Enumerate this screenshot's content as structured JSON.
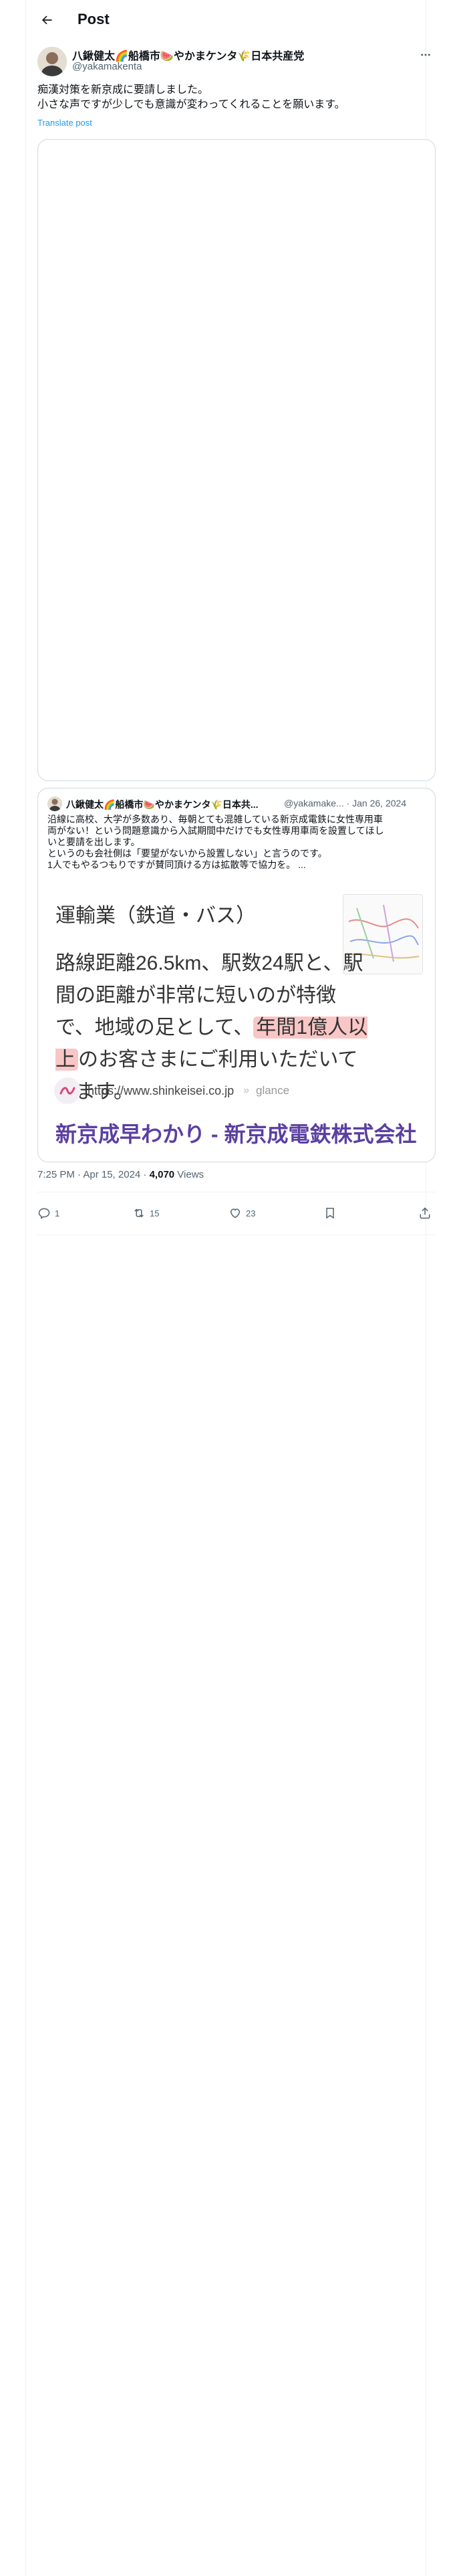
{
  "header": {
    "title": "Post"
  },
  "author": {
    "name": "八鍬健太🌈船橋市🍉やかまケンタ🌾日本共産党",
    "handle": "@yakamakenta"
  },
  "tweet": {
    "lines": [
      "痴漢対策を新京成に要請しました。",
      "小さな声ですが少しでも意識が変わってくれることを願います。"
    ],
    "translate": "Translate post"
  },
  "quote": {
    "name": "八鍬健太🌈船橋市🍉やかまケンタ🌾日本共...",
    "handle": "@yakamake...",
    "dot": "·",
    "date": "Jan 26, 2024",
    "body": [
      "沿線に高校、大学が多数あり、毎朝とても混雑している新京成電鉄に女性専用車",
      "両がない！という問題意識から入試期間中だけでも女性専用車両を設置してほし",
      "いと要請を出します。",
      "というのも会社側は「要望がないから設置しない」と言うのです。",
      "1人でもやるつもりですが賛同頂ける方は拡散等で協力を。 ..."
    ],
    "card": {
      "heading": "運輸業（鉄道・バス）",
      "route_pre": "路線距離26.5km、駅数24駅と、駅間の距離が非常に短いのが特徴で、地域の足として、",
      "route_highlight": "年間1億人以上",
      "route_post": "のお客さまにご利用いただいています。",
      "url": "https://www.shinkeisei.co.jp",
      "separator": "»",
      "glance": "glance",
      "site_title": "新京成早わかり - 新京成電鉄株式会社"
    }
  },
  "meta": {
    "time": "7:25 PM · Apr 15, 2024 · ",
    "views_count": "4,070",
    "views_label": " Views"
  },
  "actions": {
    "replies": "1",
    "reposts": "15",
    "likes": "23"
  },
  "colors": {
    "link": "#1d9bf0",
    "text": "#0f1419",
    "muted": "#536471",
    "site_title": "#5b3fa2",
    "highlight": "#f9c6c6"
  }
}
